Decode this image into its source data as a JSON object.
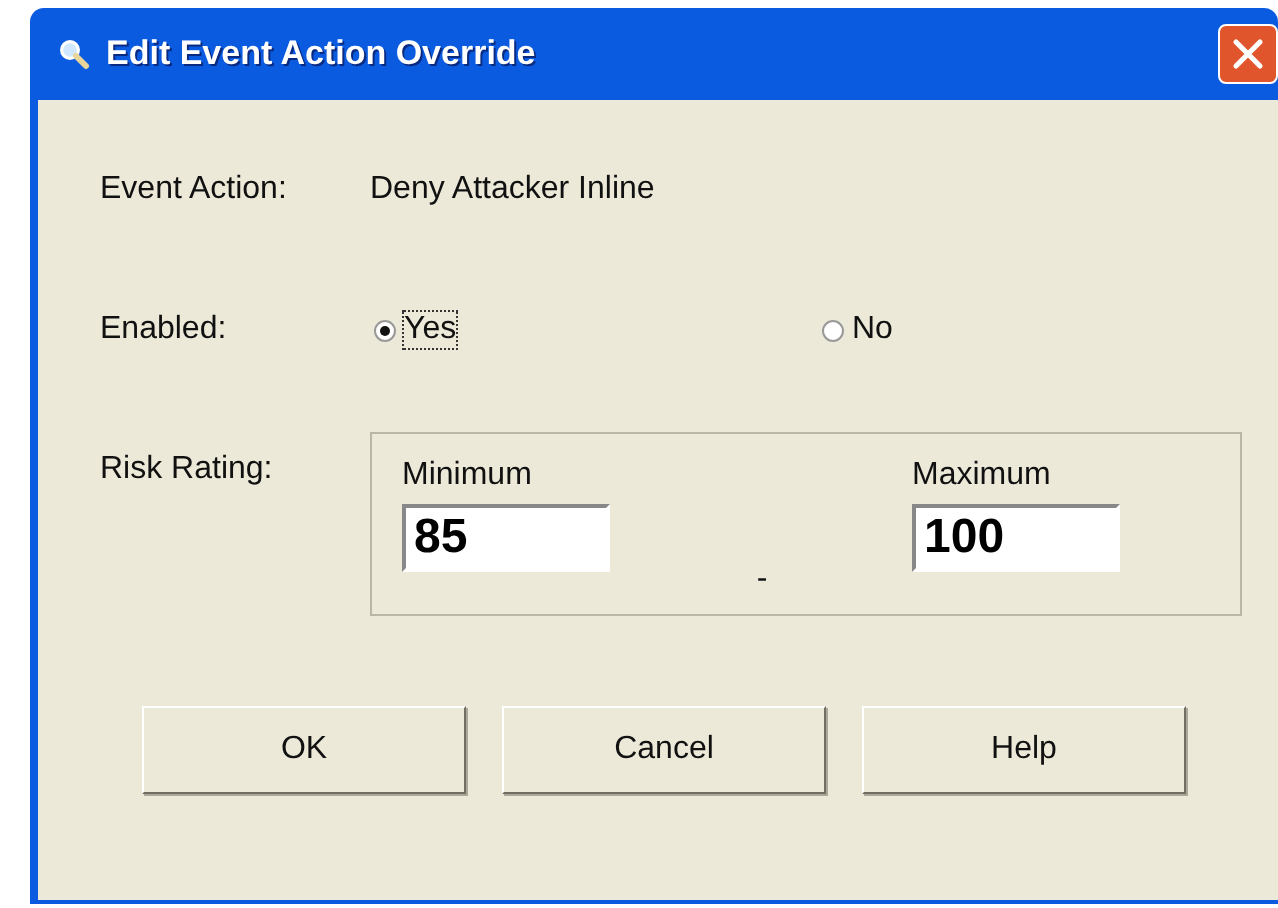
{
  "window": {
    "title": "Edit Event Action Override"
  },
  "event_action": {
    "label": "Event Action:",
    "value": "Deny Attacker Inline"
  },
  "enabled": {
    "label": "Enabled:",
    "options": [
      {
        "label": "Yes",
        "selected": true
      },
      {
        "label": "No",
        "selected": false
      }
    ]
  },
  "risk_rating": {
    "label": "Risk Rating:",
    "minimum": {
      "label": "Minimum",
      "value": "85"
    },
    "separator": "-",
    "maximum": {
      "label": "Maximum",
      "value": "100"
    }
  },
  "buttons": [
    "OK",
    "Cancel",
    "Help"
  ]
}
